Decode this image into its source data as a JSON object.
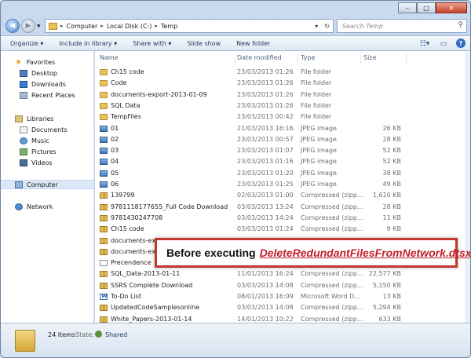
{
  "address": {
    "crumbs": [
      "Computer",
      "Local Disk (C:)",
      "Temp"
    ],
    "search_placeholder": "Search Temp"
  },
  "toolbar": {
    "items": [
      "Organize ▾",
      "Include in library ▾",
      "Share with ▾",
      "Slide show",
      "New folder"
    ]
  },
  "nav": {
    "favorites": "Favorites",
    "favorites_items": [
      "Desktop",
      "Downloads",
      "Recent Places"
    ],
    "libraries": "Libraries",
    "libraries_items": [
      "Documents",
      "Music",
      "Pictures",
      "Videos"
    ],
    "computer": "Computer",
    "network": "Network"
  },
  "columns": {
    "name": "Name",
    "date": "Date modified",
    "type": "Type",
    "size": "Size"
  },
  "files": [
    {
      "name": "Ch15 code",
      "date": "23/03/2013 01:26",
      "type": "File folder",
      "size": "",
      "icon": "folder"
    },
    {
      "name": "Code",
      "date": "23/03/2013 01:26",
      "type": "File folder",
      "size": "",
      "icon": "folder"
    },
    {
      "name": "documents-export-2013-01-09",
      "date": "23/03/2013 01:26",
      "type": "File folder",
      "size": "",
      "icon": "folder"
    },
    {
      "name": "SQL Data",
      "date": "23/03/2013 01:26",
      "type": "File folder",
      "size": "",
      "icon": "folder"
    },
    {
      "name": "TempFiles",
      "date": "23/03/2013 00:42",
      "type": "File folder",
      "size": "",
      "icon": "folder"
    },
    {
      "name": "01",
      "date": "21/03/2013 16:16",
      "type": "JPEG image",
      "size": "26 KB",
      "icon": "jpeg"
    },
    {
      "name": "02",
      "date": "23/03/2013 00:57",
      "type": "JPEG image",
      "size": "28 KB",
      "icon": "jpeg"
    },
    {
      "name": "03",
      "date": "23/03/2013 01:07",
      "type": "JPEG image",
      "size": "52 KB",
      "icon": "jpeg"
    },
    {
      "name": "04",
      "date": "23/03/2013 01:16",
      "type": "JPEG image",
      "size": "52 KB",
      "icon": "jpeg"
    },
    {
      "name": "05",
      "date": "23/03/2013 01:20",
      "type": "JPEG image",
      "size": "38 KB",
      "icon": "jpeg"
    },
    {
      "name": "06",
      "date": "23/03/2013 01:25",
      "type": "JPEG image",
      "size": "49 KB",
      "icon": "jpeg"
    },
    {
      "name": "139799",
      "date": "02/03/2013 01:00",
      "type": "Compressed (zipp...",
      "size": "1,610 KB",
      "icon": "zip"
    },
    {
      "name": "9781118177655_Full Code Download",
      "date": "03/03/2013 13:24",
      "type": "Compressed (zipp...",
      "size": "28 KB",
      "icon": "zip"
    },
    {
      "name": "9781430247708",
      "date": "03/03/2013 14:24",
      "type": "Compressed (zipp...",
      "size": "11 KB",
      "icon": "zip"
    },
    {
      "name": "Ch15 code",
      "date": "03/03/2013 01:24",
      "type": "Compressed (zipp...",
      "size": "9 KB",
      "icon": "zip"
    },
    {
      "name": "documents-export-2013-01-09",
      "date": "",
      "type": "",
      "size": "",
      "icon": "zip"
    },
    {
      "name": "documents-export",
      "date": "",
      "type": "",
      "size": "",
      "icon": "zip"
    },
    {
      "name": "Precendence",
      "date": "",
      "type": "",
      "size": "",
      "icon": "txt"
    },
    {
      "name": "SQL_Data-2013-01-11",
      "date": "11/01/2013 16:24",
      "type": "Compressed (zipp...",
      "size": "22,577 KB",
      "icon": "zip"
    },
    {
      "name": "SSRS Complete Download",
      "date": "03/03/2013 14:08",
      "type": "Compressed (zipp...",
      "size": "5,150 KB",
      "icon": "zip"
    },
    {
      "name": "To-Do List",
      "date": "08/01/2013 16:09",
      "type": "Microsoft Word D...",
      "size": "13 KB",
      "icon": "doc"
    },
    {
      "name": "UpdatedCodeSamplesonline",
      "date": "03/03/2013 14:08",
      "type": "Compressed (zipp...",
      "size": "5,294 KB",
      "icon": "zip"
    },
    {
      "name": "White_Papers-2013-01-14",
      "date": "14/01/2013 10:22",
      "type": "Compressed (zipp...",
      "size": "633 KB",
      "icon": "zip"
    },
    {
      "name": "",
      "date": "",
      "type": "",
      "size": "",
      "icon": "zip"
    }
  ],
  "status": {
    "count": "24 items",
    "state_label": "State:",
    "state_value": "Shared"
  },
  "callout": {
    "prefix": "Before executing",
    "package": "DeleteRedundantFilesFromNetwork.dtsx"
  }
}
